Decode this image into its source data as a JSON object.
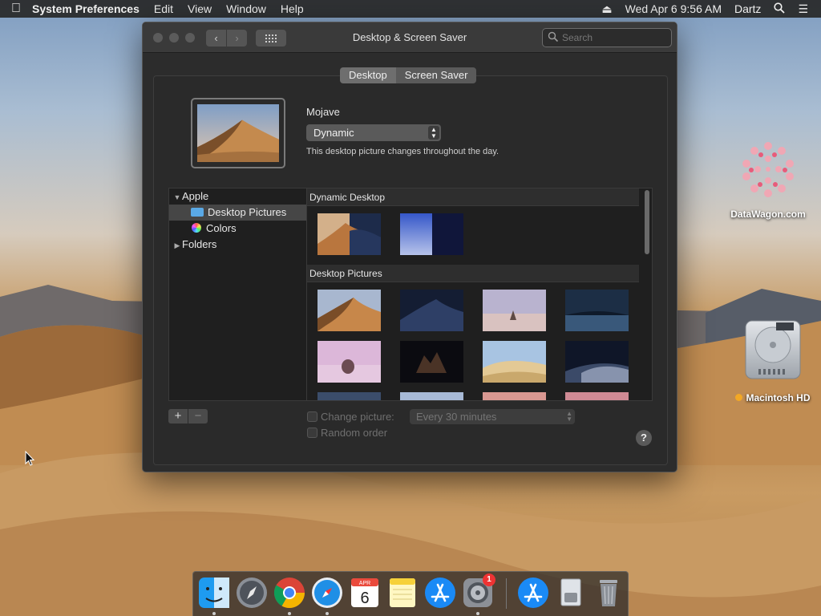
{
  "menubar": {
    "apple_icon": "apple-logo-icon",
    "app_name": "System Preferences",
    "menus": [
      "Edit",
      "View",
      "Window",
      "Help"
    ],
    "datetime": "Wed Apr 6  9:56 AM",
    "user": "Dartz",
    "status_icons": [
      "eject-icon",
      "spotlight-search-icon",
      "notification-center-icon"
    ]
  },
  "window": {
    "title": "Desktop & Screen Saver",
    "search_placeholder": "Search",
    "tabs": [
      "Desktop",
      "Screen Saver"
    ],
    "active_tab": "Desktop",
    "wallpaper_name": "Mojave",
    "wallpaper_mode": "Dynamic",
    "wallpaper_description": "This desktop picture changes throughout the day.",
    "sidebar": {
      "group": "Apple",
      "items": [
        "Desktop Pictures",
        "Colors"
      ],
      "selected": "Desktop Pictures",
      "folders": "Folders"
    },
    "gallery": {
      "sections": [
        "Dynamic Desktop",
        "Desktop Pictures"
      ]
    },
    "add_label": "+",
    "remove_label": "−",
    "change_picture_label": "Change picture:",
    "interval": "Every 30 minutes",
    "random_order_label": "Random order",
    "help_label": "?"
  },
  "desktop": {
    "items": [
      "DataWagon.com",
      "Macintosh HD"
    ]
  },
  "dock": {
    "apps": [
      "Finder",
      "Launchpad",
      "Google Chrome",
      "Safari",
      "Calendar",
      "Notes",
      "App Store",
      "System Preferences",
      "Downloads",
      "Documents",
      "Trash"
    ],
    "calendar_month": "APR",
    "calendar_day": "6",
    "badge_count": "1"
  },
  "colors": {
    "accent": "#5aa9e6",
    "window_bg": "#2c2c2c",
    "badge": "#e33333"
  }
}
